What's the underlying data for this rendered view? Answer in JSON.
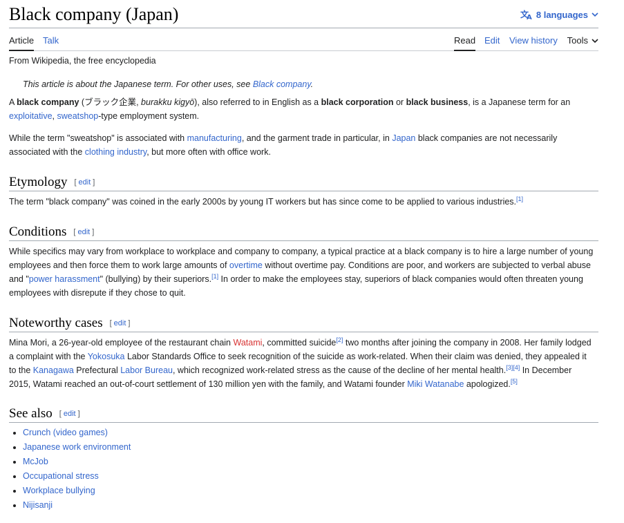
{
  "header": {
    "title": "Black company (Japan)",
    "languages_label": "8 languages"
  },
  "tabs": {
    "article": "Article",
    "talk": "Talk",
    "read": "Read",
    "edit": "Edit",
    "view_history": "View history",
    "tools": "Tools"
  },
  "tagline": "From Wikipedia, the free encyclopedia",
  "hatnote": {
    "text": "This article is about the Japanese term. For other uses, see ",
    "link": "Black company",
    "end": "."
  },
  "lead": {
    "p1": {
      "a": "A ",
      "b1": "black company",
      "c": " (ブラック企業, ",
      "d": "burakku kigyō",
      "e": "), also referred to in English as a ",
      "b2": "black corporation",
      "f": " or ",
      "b3": "black business",
      "g": ", is a Japanese term for an",
      "link1": "exploitative",
      "h": ", ",
      "link2": "sweatshop",
      "i": "-type employment system."
    },
    "p2": {
      "a": "While the term \"sweatshop\" is associated with ",
      "link1": "manufacturing",
      "b": ", and the garment trade in particular, in ",
      "link2": "Japan",
      "c": " black companies are not necessarily",
      "d": "associated with the ",
      "link3": "clothing industry",
      "e": ", but more often with office work."
    }
  },
  "edit_label": "edit",
  "sections": {
    "etymology": {
      "title": "Etymology",
      "text": "The term \"black company\" was coined in the early 2000s by young IT workers but has since come to be applied to various industries.",
      "ref": "[1]"
    },
    "conditions": {
      "title": "Conditions",
      "a": "While specifics may vary from workplace to workplace and company to company, a typical practice at a black company is to hire a large number of young",
      "b": "employees and then force them to work large amounts of ",
      "link1": "overtime",
      "c": " without overtime pay. Conditions are poor, and workers are subjected to verbal abuse",
      "d": "and \"",
      "link2": "power harassment",
      "e": "\" (bullying) by their superiors.",
      "ref": "[1]",
      "f": " In order to make the employees stay, superiors of black companies would often threaten young",
      "g": "employees with disrepute if they chose to quit."
    },
    "noteworthy": {
      "title": "Noteworthy cases",
      "a": "Mina Mori, a 26-year-old employee of the restaurant chain ",
      "link_watami": "Watami",
      "b": ", committed suicide",
      "ref2": "[2]",
      "c": " two months after joining the company in 2008. Her family lodged",
      "d": "a complaint with the ",
      "link_yokosuka": "Yokosuka",
      "e": " Labor Standards Office to seek recognition of the suicide as work-related. When their claim was denied, they appealed it",
      "f": "to the ",
      "link_kanagawa": "Kanagawa",
      "g": " Prefectural ",
      "link_labor_bureau": "Labor Bureau",
      "h": ", which recognized work-related stress as the cause of the decline of her mental health.",
      "ref3": "[3]",
      "ref4": "[4]",
      "i": " In December",
      "j": "2015, Watami reached an out-of-court settlement of 130 million yen with the family, and Watami founder ",
      "link_miki": "Miki Watanabe",
      "k": " apologized.",
      "ref5": "[5]"
    },
    "see_also": {
      "title": "See also",
      "items": [
        "Crunch (video games)",
        "Japanese work environment",
        "McJob",
        "Occupational stress",
        "Workplace bullying",
        "Nijisanji"
      ]
    }
  },
  "colors": {
    "link": "#3366cc",
    "redlink": "#d73333",
    "text": "#202122"
  }
}
